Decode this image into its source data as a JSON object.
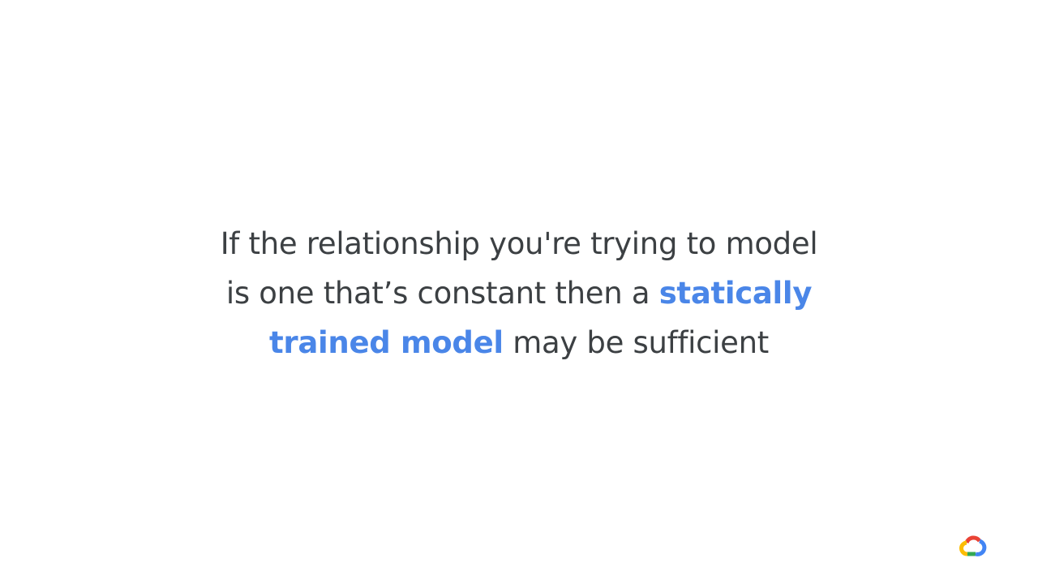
{
  "slide": {
    "lines": [
      {
        "parts": [
          {
            "text": "If the relationship you're trying to model",
            "highlight": false
          }
        ]
      },
      {
        "parts": [
          {
            "text": "is one that’s constant then a ",
            "highlight": false
          },
          {
            "text": "statically",
            "highlight": true
          }
        ]
      },
      {
        "parts": [
          {
            "text": "trained model",
            "highlight": true
          },
          {
            "text": " may be sufficient",
            "highlight": false
          }
        ]
      }
    ],
    "colors": {
      "text": "#3c4043",
      "highlight": "#4a86e8",
      "background": "#ffffff"
    }
  },
  "logo": {
    "icon": "google-cloud-logo-icon",
    "colors": [
      "#ea4335",
      "#fbbc04",
      "#34a853",
      "#4285f4"
    ]
  }
}
